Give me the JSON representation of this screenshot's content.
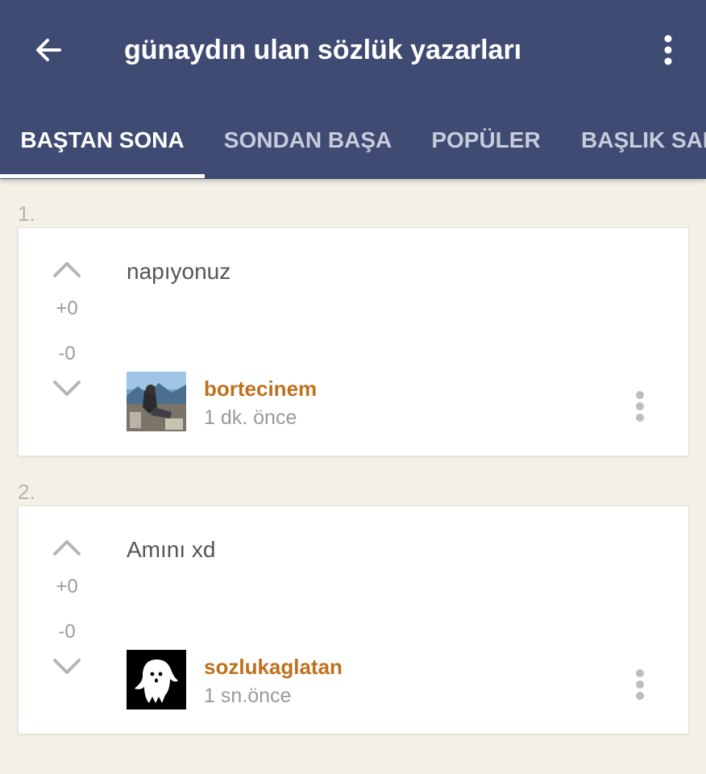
{
  "header": {
    "title": "günaydın ulan sözlük yazarları",
    "back_icon": "arrow-left-icon",
    "menu_icon": "more-vertical-icon"
  },
  "tabs": [
    {
      "label": "BAŞTAN SONA",
      "active": true
    },
    {
      "label": "SONDAN BAŞA",
      "active": false
    },
    {
      "label": "POPÜLER",
      "active": false
    },
    {
      "label": "BAŞLIK SAHİBİ",
      "active": false
    }
  ],
  "entries": [
    {
      "index": "1.",
      "upvotes": "+0",
      "downvotes": "-0",
      "text": "napıyonuz",
      "author": "bortecinem",
      "time": "1 dk. önce",
      "avatar": "photo-avatar"
    },
    {
      "index": "2.",
      "upvotes": "+0",
      "downvotes": "-0",
      "text": "Amını xd",
      "author": "sozlukaglatan",
      "time": "1 sn.önce",
      "avatar": "ghost-avatar"
    }
  ],
  "colors": {
    "appbar": "#3f4b72",
    "background": "#f3f1e6",
    "author": "#c0701c",
    "muted": "#9a9a9a"
  }
}
